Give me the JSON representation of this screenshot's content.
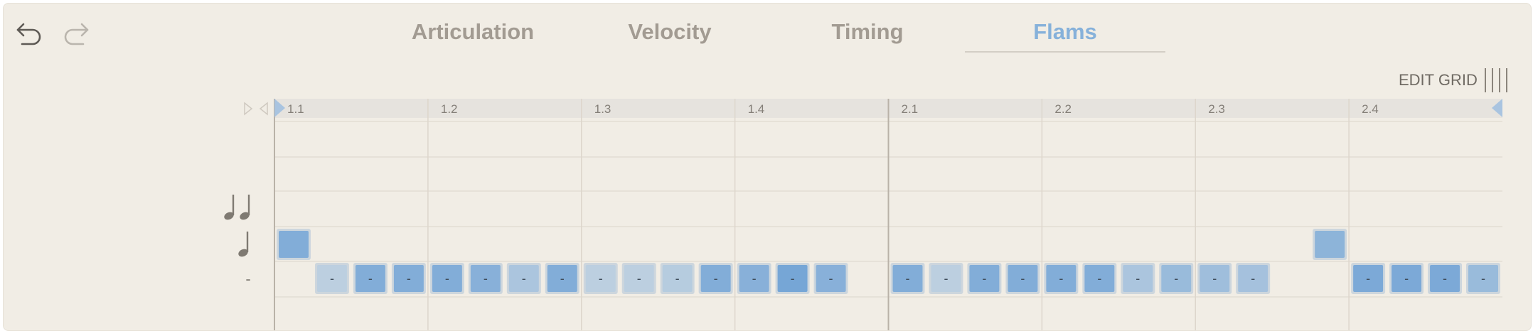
{
  "toolbar": {
    "undo_icon": "undo-icon",
    "redo_icon": "redo-icon"
  },
  "tabs": [
    {
      "label": "Articulation",
      "active": false
    },
    {
      "label": "Velocity",
      "active": false
    },
    {
      "label": "Timing",
      "active": false
    },
    {
      "label": "Flams",
      "active": true
    }
  ],
  "edit_grid": {
    "label": "EDIT GRID",
    "icon": "grid-columns-icon"
  },
  "ruler": {
    "beats": [
      "1.1",
      "1.2",
      "1.3",
      "1.4",
      "2.1",
      "2.2",
      "2.3",
      "2.4"
    ],
    "start_marker_icon": "loop-start-icon",
    "end_marker_icon": "loop-end-icon",
    "play_icon": "play-outline-icon",
    "rewind_icon": "rewind-outline-icon"
  },
  "rows": [
    {
      "id": "double",
      "label": "♩♩",
      "icon": "double-quarter-note-icon"
    },
    {
      "id": "single",
      "label": "♩",
      "icon": "quarter-note-icon"
    },
    {
      "id": "none",
      "label": "-",
      "icon": ""
    }
  ],
  "steps_per_beat": 4,
  "step_cell_label": "-",
  "steps": [
    {
      "row": "single",
      "velocity": 0.8
    },
    {
      "row": "none",
      "velocity": 0.3
    },
    {
      "row": "none",
      "velocity": 0.8
    },
    {
      "row": "none",
      "velocity": 0.8
    },
    {
      "row": "none",
      "velocity": 0.8
    },
    {
      "row": "none",
      "velocity": 0.75
    },
    {
      "row": "none",
      "velocity": 0.45
    },
    {
      "row": "none",
      "velocity": 0.8
    },
    {
      "row": "none",
      "velocity": 0.3
    },
    {
      "row": "none",
      "velocity": 0.3
    },
    {
      "row": "none",
      "velocity": 0.35
    },
    {
      "row": "none",
      "velocity": 0.8
    },
    {
      "row": "none",
      "velocity": 0.75
    },
    {
      "row": "none",
      "velocity": 0.9
    },
    {
      "row": "none",
      "velocity": 0.75
    },
    {
      "row": "off",
      "velocity": 0
    },
    {
      "row": "none",
      "velocity": 0.8
    },
    {
      "row": "none",
      "velocity": 0.3
    },
    {
      "row": "none",
      "velocity": 0.8
    },
    {
      "row": "none",
      "velocity": 0.8
    },
    {
      "row": "none",
      "velocity": 0.8
    },
    {
      "row": "none",
      "velocity": 0.8
    },
    {
      "row": "none",
      "velocity": 0.45
    },
    {
      "row": "none",
      "velocity": 0.6
    },
    {
      "row": "none",
      "velocity": 0.55
    },
    {
      "row": "none",
      "velocity": 0.5
    },
    {
      "row": "off",
      "velocity": 0
    },
    {
      "row": "single",
      "velocity": 0.7
    },
    {
      "row": "none",
      "velocity": 0.85
    },
    {
      "row": "none",
      "velocity": 0.85
    },
    {
      "row": "none",
      "velocity": 0.85
    },
    {
      "row": "none",
      "velocity": 0.6
    }
  ],
  "colors": {
    "background": "#f1ede5",
    "accent": "#86b1da",
    "tab_inactive": "#a29b92",
    "cell_strong": "#76a6d6",
    "cell_weak": "#bccfe0",
    "ruler": "#e6e3de",
    "grid_line": "#ddd6cc"
  }
}
